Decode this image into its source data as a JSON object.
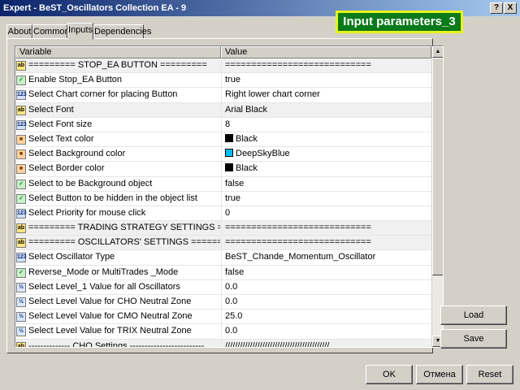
{
  "window": {
    "title": "Expert - BeST_Oscillators Collection EA - 9",
    "help_btn": "?",
    "close_btn": "X"
  },
  "banner": "Input parameters_3",
  "tabs": [
    {
      "label": "About"
    },
    {
      "label": "Common"
    },
    {
      "label": "Inputs"
    },
    {
      "label": "Dependencies"
    }
  ],
  "grid": {
    "col_variable": "Variable",
    "col_value": "Value",
    "rows": [
      {
        "icon": "ab",
        "var": "========= STOP_EA BUTTON =========",
        "val": "============================"
      },
      {
        "icon": "bool",
        "var": "Enable Stop_EA Button",
        "val": "true"
      },
      {
        "icon": "123",
        "var": "Select Chart corner for placing Button",
        "val": "Right lower chart corner"
      },
      {
        "icon": "ab",
        "var": "Select Font",
        "val": "Arial Black"
      },
      {
        "icon": "123",
        "var": "Select Font size",
        "val": "8"
      },
      {
        "icon": "col",
        "var": "Select Text color",
        "val": "Black",
        "swatch": "#000000"
      },
      {
        "icon": "col",
        "var": "Select Background color",
        "val": "DeepSkyBlue",
        "swatch": "#00bfff"
      },
      {
        "icon": "col",
        "var": "Select Border color",
        "val": "Black",
        "swatch": "#000000"
      },
      {
        "icon": "bool",
        "var": "Select to be Background object",
        "val": "false"
      },
      {
        "icon": "bool",
        "var": "Select Button to be hidden in the object list",
        "val": "true"
      },
      {
        "icon": "123",
        "var": "Select Priority for mouse click",
        "val": "0"
      },
      {
        "icon": "ab",
        "var": "========= TRADING STRATEGY SETTINGS =========",
        "val": "============================"
      },
      {
        "icon": "ab",
        "var": "========= OSCILLATORS' SETTINGS ============",
        "val": "============================"
      },
      {
        "icon": "123",
        "var": "Select Oscillator Type",
        "val": "BeST_Chande_Momentum_Oscillator"
      },
      {
        "icon": "bool",
        "var": "Reverse_Mode or MultiTrades _Mode",
        "val": "false"
      },
      {
        "icon": "v2",
        "var": "Select Level_1 Value for all Oscillators",
        "val": "0.0"
      },
      {
        "icon": "v2",
        "var": "Select Level Value for CHO Neutral Zone",
        "val": "0.0"
      },
      {
        "icon": "v2",
        "var": "Select Level Value for CMO Neutral Zone",
        "val": "25.0"
      },
      {
        "icon": "v2",
        "var": "Select Level Value for TRIX Neutral Zone",
        "val": "0.0"
      },
      {
        "icon": "ab",
        "var": "-------------- CHO Settings -------------------------",
        "val": "//////////////////////////////////////////"
      }
    ]
  },
  "buttons": {
    "load": "Load",
    "save": "Save",
    "ok": "OK",
    "cancel": "Отмена",
    "reset": "Reset"
  }
}
